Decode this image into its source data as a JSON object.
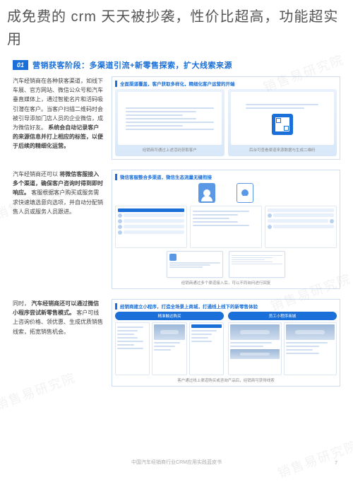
{
  "page_title": "成免费的 crm 天天被抄袭，性价比超高，功能超实用",
  "section": {
    "number": "01",
    "title": "营销获客阶段：多渠道引流+新零售探索，扩大线索来源"
  },
  "rows": [
    {
      "text_before_bold": "汽车经销商在各种获客渠道，如线下车展、官方网站、微信公众号和汽车垂直媒体上，通过智能名片和活码吸引潜在客户。当客户扫描二维码时会被引导添加门店人员的企业微信，成为微信好友。",
      "text_bold": "系统会自动记录客户的来源信息并打上相应的标签，以便于后续的精细化运营。",
      "slide_title": "全面渠道覆盖，客户获取多样化，精细化客户运营的开端",
      "caption_left": "经销商可通过上述活码获取客户",
      "caption_right": "后台可查看渠道来源数据与生成二维码"
    },
    {
      "text_before": "汽车经销商还可以",
      "text_bold1": "将微信客服接入多个渠道，确保客户咨询时得到即时响应。",
      "text_after1": "客服根据客户购买或服务需求快速填选意向选项，并自动分配销售人员或服务人员跟进。",
      "slide_title": "微信客服整合多渠道，微信生态流量无缝衔接",
      "caption": "经销商通过多个渠道接入后，可以不同询问进行回复"
    },
    {
      "text_before": "同时，",
      "text_bold": "汽车经销商还可以通过微信小程序尝试新零售模式。",
      "text_after": "客户可线上咨询价格、领优惠、生成优质销售线索，拓宽销售机会。",
      "slide_title": "经销商建立小程序，打造全场景上商城，打通线上线下的新零售体验",
      "label_left": "精准触达购买",
      "label_right": "员工小程序商城",
      "caption": "客户通过线上渠道购买或咨询产品后，经销商可获得线索"
    }
  ],
  "footer": "中国汽车经销商行业CRM应用实践蓝皮书",
  "page_number": "7",
  "watermark": "销售易研究院"
}
